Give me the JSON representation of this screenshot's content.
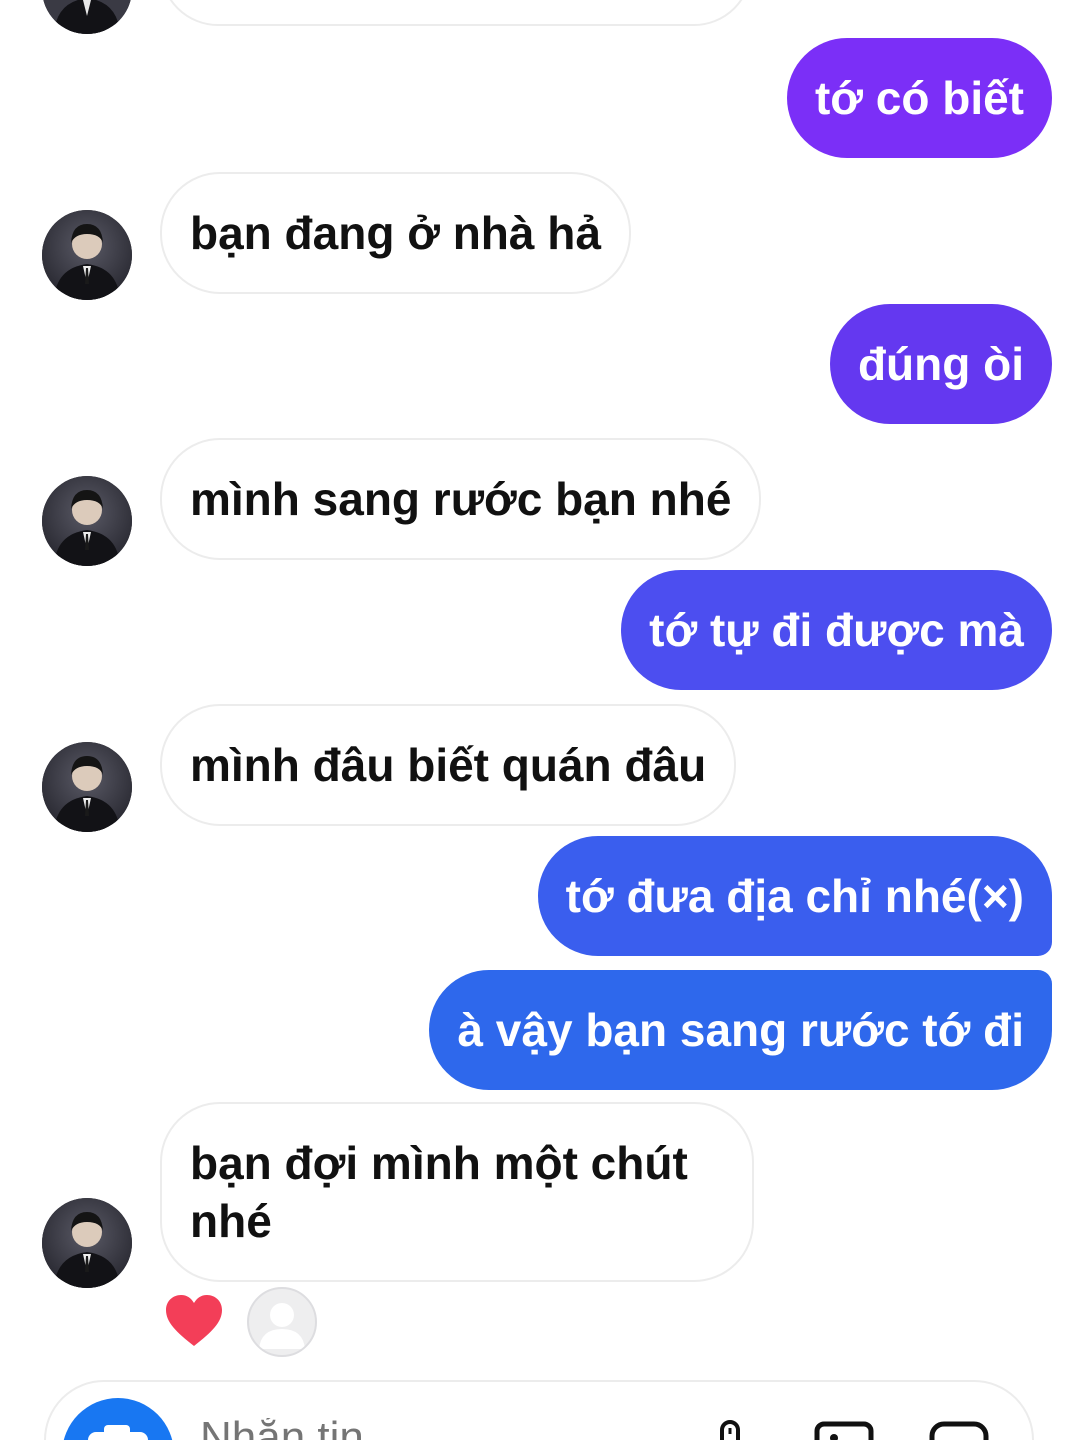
{
  "messages": [
    {
      "side": "out",
      "text": "tớ có biết",
      "color": "#7b2ff7"
    },
    {
      "side": "in",
      "text": "bạn đang ở nhà hả"
    },
    {
      "side": "out",
      "text": "đúng òi",
      "color": "#6438f0"
    },
    {
      "side": "in",
      "text": "mình sang rước bạn nhé"
    },
    {
      "side": "out",
      "text": "tớ tự đi được mà",
      "color": "#4c4ef0"
    },
    {
      "side": "in",
      "text": "mình đâu biết quán đâu"
    },
    {
      "side": "out",
      "text": "tớ đưa địa chỉ nhé(×)",
      "color": "#3a5eee"
    },
    {
      "side": "out",
      "text": "à vậy bạn sang rước tớ đi",
      "color": "#2e68ec"
    },
    {
      "side": "in",
      "text": "bạn đợi mình một chút nhé"
    }
  ],
  "reaction": {
    "icon": "heart-icon",
    "color": "#f33e58"
  },
  "composer": {
    "placeholder": "Nhắn tin",
    "camera_color": "#1877f2"
  },
  "icons": [
    "camera-icon",
    "microphone-icon",
    "image-icon",
    "sticker-icon",
    "avatar-icon",
    "heart-icon",
    "seen-avatar-icon"
  ]
}
